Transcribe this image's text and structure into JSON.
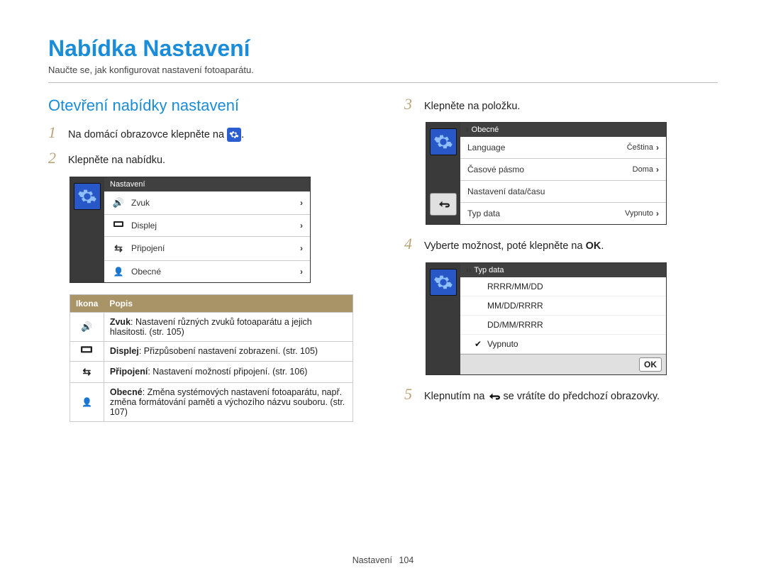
{
  "page": {
    "title": "Nabídka Nastavení",
    "subtitle": "Naučte se, jak konfigurovat nastavení fotoaparátu.",
    "footer_label": "Nastavení",
    "page_number": "104"
  },
  "left": {
    "section_title": "Otevření nabídky nastavení",
    "step1": {
      "num": "1",
      "text": "Na domácí obrazovce klepněte na",
      "suffix": "."
    },
    "step2": {
      "num": "2",
      "text": "Klepněte na nabídku."
    },
    "screen1": {
      "title": "Nastavení",
      "rows": [
        {
          "icon": "sound",
          "label": "Zvuk"
        },
        {
          "icon": "display",
          "label": "Displej"
        },
        {
          "icon": "connect",
          "label": "Připojení"
        },
        {
          "icon": "general",
          "label": "Obecné"
        }
      ]
    },
    "table": {
      "headers": {
        "icon": "Ikona",
        "desc": "Popis"
      },
      "rows": [
        {
          "icon": "sound",
          "bold": "Zvuk",
          "text": ": Nastavení různých zvuků fotoaparátu a jejich hlasitosti. (str. 105)"
        },
        {
          "icon": "display",
          "bold": "Displej",
          "text": ": Přizpůsobení nastavení zobrazení. (str. 105)"
        },
        {
          "icon": "connect",
          "bold": "Připojení",
          "text": ": Nastavení možností připojení. (str. 106)"
        },
        {
          "icon": "general",
          "bold": "Obecné",
          "text": ": Změna systémových nastavení fotoaparátu, např. změna formátování paměti a výchozího názvu souboru. (str. 107)"
        }
      ]
    }
  },
  "right": {
    "step3": {
      "num": "3",
      "text": "Klepněte na položku."
    },
    "screen2": {
      "title": "Obecné",
      "rows": [
        {
          "label": "Language",
          "value": "Čeština"
        },
        {
          "label": "Časové pásmo",
          "value": "Doma"
        },
        {
          "label": "Nastavení data/času",
          "value": ""
        },
        {
          "label": "Typ data",
          "value": "Vypnuto"
        }
      ]
    },
    "step4": {
      "num": "4",
      "text": "Vyberte možnost, poté klepněte na",
      "ok": "OK",
      "suffix": "."
    },
    "screen3": {
      "title": "Typ data",
      "options": [
        {
          "label": "RRRR/MM/DD",
          "checked": false
        },
        {
          "label": "MM/DD/RRRR",
          "checked": false
        },
        {
          "label": "DD/MM/RRRR",
          "checked": false
        },
        {
          "label": "Vypnuto",
          "checked": true
        }
      ],
      "ok": "OK"
    },
    "step5": {
      "num": "5",
      "pre": "Klepnutím na",
      "post": "se vrátíte do předchozí obrazovky."
    }
  }
}
